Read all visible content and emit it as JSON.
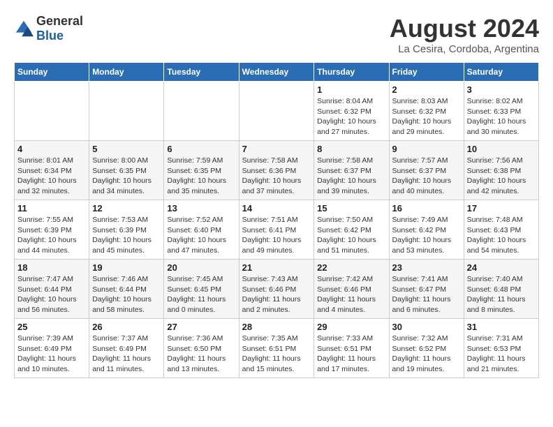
{
  "logo": {
    "general": "General",
    "blue": "Blue"
  },
  "title": "August 2024",
  "location": "La Cesira, Cordoba, Argentina",
  "weekdays": [
    "Sunday",
    "Monday",
    "Tuesday",
    "Wednesday",
    "Thursday",
    "Friday",
    "Saturday"
  ],
  "weeks": [
    [
      {
        "day": "",
        "info": ""
      },
      {
        "day": "",
        "info": ""
      },
      {
        "day": "",
        "info": ""
      },
      {
        "day": "",
        "info": ""
      },
      {
        "day": "1",
        "info": "Sunrise: 8:04 AM\nSunset: 6:32 PM\nDaylight: 10 hours\nand 27 minutes."
      },
      {
        "day": "2",
        "info": "Sunrise: 8:03 AM\nSunset: 6:32 PM\nDaylight: 10 hours\nand 29 minutes."
      },
      {
        "day": "3",
        "info": "Sunrise: 8:02 AM\nSunset: 6:33 PM\nDaylight: 10 hours\nand 30 minutes."
      }
    ],
    [
      {
        "day": "4",
        "info": "Sunrise: 8:01 AM\nSunset: 6:34 PM\nDaylight: 10 hours\nand 32 minutes."
      },
      {
        "day": "5",
        "info": "Sunrise: 8:00 AM\nSunset: 6:35 PM\nDaylight: 10 hours\nand 34 minutes."
      },
      {
        "day": "6",
        "info": "Sunrise: 7:59 AM\nSunset: 6:35 PM\nDaylight: 10 hours\nand 35 minutes."
      },
      {
        "day": "7",
        "info": "Sunrise: 7:58 AM\nSunset: 6:36 PM\nDaylight: 10 hours\nand 37 minutes."
      },
      {
        "day": "8",
        "info": "Sunrise: 7:58 AM\nSunset: 6:37 PM\nDaylight: 10 hours\nand 39 minutes."
      },
      {
        "day": "9",
        "info": "Sunrise: 7:57 AM\nSunset: 6:37 PM\nDaylight: 10 hours\nand 40 minutes."
      },
      {
        "day": "10",
        "info": "Sunrise: 7:56 AM\nSunset: 6:38 PM\nDaylight: 10 hours\nand 42 minutes."
      }
    ],
    [
      {
        "day": "11",
        "info": "Sunrise: 7:55 AM\nSunset: 6:39 PM\nDaylight: 10 hours\nand 44 minutes."
      },
      {
        "day": "12",
        "info": "Sunrise: 7:53 AM\nSunset: 6:39 PM\nDaylight: 10 hours\nand 45 minutes."
      },
      {
        "day": "13",
        "info": "Sunrise: 7:52 AM\nSunset: 6:40 PM\nDaylight: 10 hours\nand 47 minutes."
      },
      {
        "day": "14",
        "info": "Sunrise: 7:51 AM\nSunset: 6:41 PM\nDaylight: 10 hours\nand 49 minutes."
      },
      {
        "day": "15",
        "info": "Sunrise: 7:50 AM\nSunset: 6:42 PM\nDaylight: 10 hours\nand 51 minutes."
      },
      {
        "day": "16",
        "info": "Sunrise: 7:49 AM\nSunset: 6:42 PM\nDaylight: 10 hours\nand 53 minutes."
      },
      {
        "day": "17",
        "info": "Sunrise: 7:48 AM\nSunset: 6:43 PM\nDaylight: 10 hours\nand 54 minutes."
      }
    ],
    [
      {
        "day": "18",
        "info": "Sunrise: 7:47 AM\nSunset: 6:44 PM\nDaylight: 10 hours\nand 56 minutes."
      },
      {
        "day": "19",
        "info": "Sunrise: 7:46 AM\nSunset: 6:44 PM\nDaylight: 10 hours\nand 58 minutes."
      },
      {
        "day": "20",
        "info": "Sunrise: 7:45 AM\nSunset: 6:45 PM\nDaylight: 11 hours\nand 0 minutes."
      },
      {
        "day": "21",
        "info": "Sunrise: 7:43 AM\nSunset: 6:46 PM\nDaylight: 11 hours\nand 2 minutes."
      },
      {
        "day": "22",
        "info": "Sunrise: 7:42 AM\nSunset: 6:46 PM\nDaylight: 11 hours\nand 4 minutes."
      },
      {
        "day": "23",
        "info": "Sunrise: 7:41 AM\nSunset: 6:47 PM\nDaylight: 11 hours\nand 6 minutes."
      },
      {
        "day": "24",
        "info": "Sunrise: 7:40 AM\nSunset: 6:48 PM\nDaylight: 11 hours\nand 8 minutes."
      }
    ],
    [
      {
        "day": "25",
        "info": "Sunrise: 7:39 AM\nSunset: 6:49 PM\nDaylight: 11 hours\nand 10 minutes."
      },
      {
        "day": "26",
        "info": "Sunrise: 7:37 AM\nSunset: 6:49 PM\nDaylight: 11 hours\nand 11 minutes."
      },
      {
        "day": "27",
        "info": "Sunrise: 7:36 AM\nSunset: 6:50 PM\nDaylight: 11 hours\nand 13 minutes."
      },
      {
        "day": "28",
        "info": "Sunrise: 7:35 AM\nSunset: 6:51 PM\nDaylight: 11 hours\nand 15 minutes."
      },
      {
        "day": "29",
        "info": "Sunrise: 7:33 AM\nSunset: 6:51 PM\nDaylight: 11 hours\nand 17 minutes."
      },
      {
        "day": "30",
        "info": "Sunrise: 7:32 AM\nSunset: 6:52 PM\nDaylight: 11 hours\nand 19 minutes."
      },
      {
        "day": "31",
        "info": "Sunrise: 7:31 AM\nSunset: 6:53 PM\nDaylight: 11 hours\nand 21 minutes."
      }
    ]
  ]
}
